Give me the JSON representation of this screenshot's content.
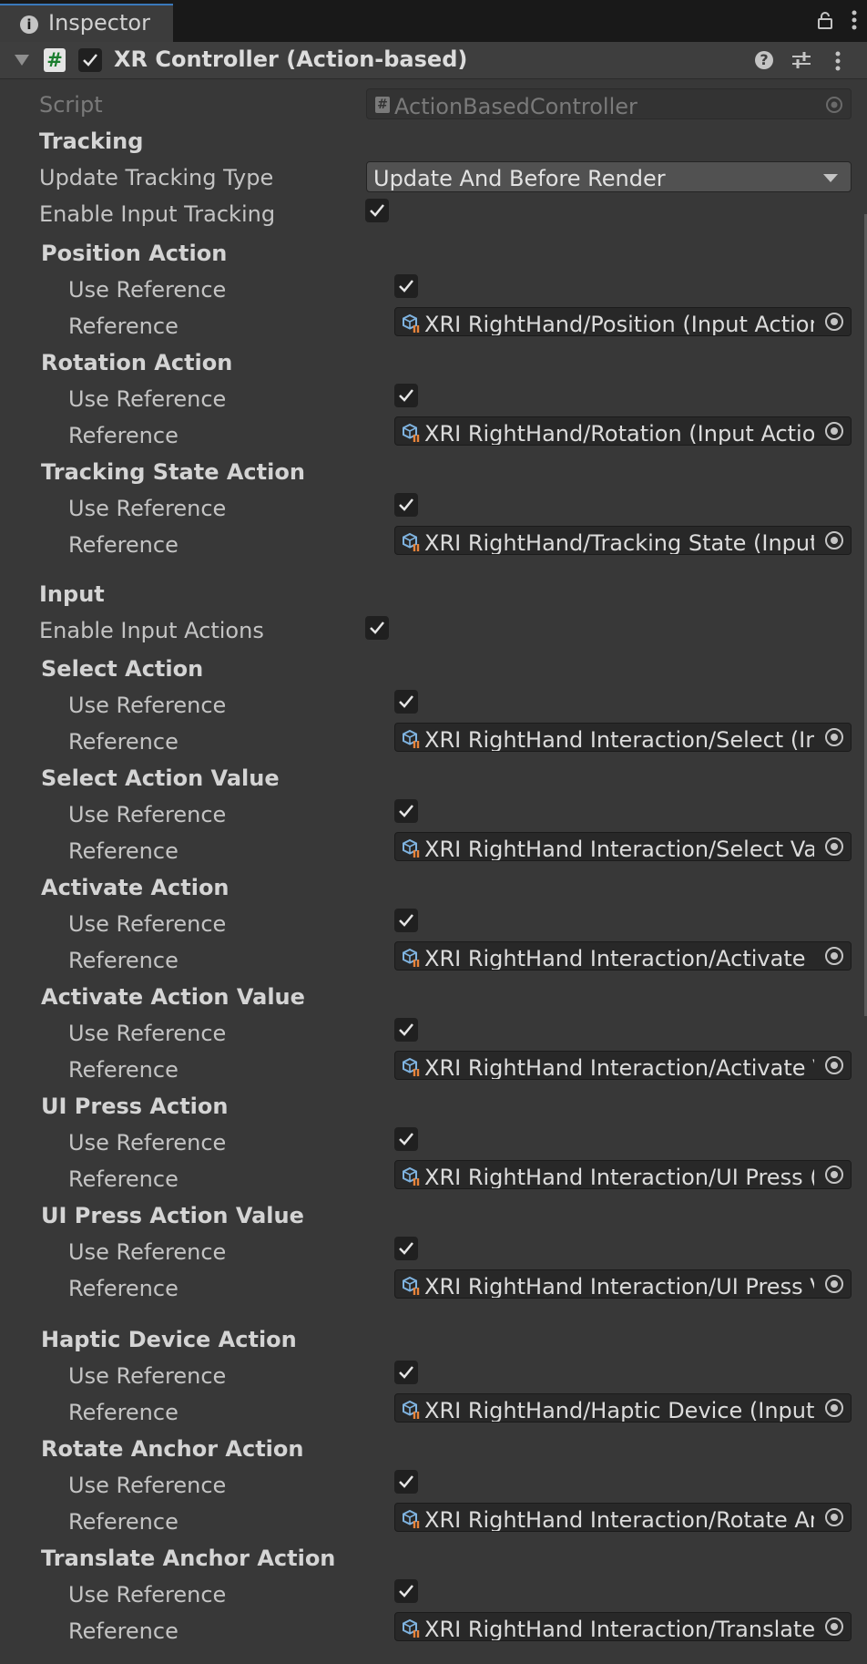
{
  "window": {
    "tab_label": "Inspector"
  },
  "component": {
    "title": "XR Controller (Action-based)"
  },
  "script": {
    "label": "Script",
    "value": "ActionBasedController"
  },
  "tracking": {
    "header": "Tracking",
    "update_tracking_type": {
      "label": "Update Tracking Type",
      "value": "Update And Before Render"
    },
    "enable_input_tracking": {
      "label": "Enable Input Tracking"
    }
  },
  "input": {
    "header": "Input",
    "enable_input_actions": {
      "label": "Enable Input Actions"
    }
  },
  "labels": {
    "use_reference": "Use Reference",
    "reference": "Reference"
  },
  "actions": [
    {
      "title": "Position Action",
      "reference": "XRI RightHand/Position (Input Action Reference)"
    },
    {
      "title": "Rotation Action",
      "reference": "XRI RightHand/Rotation (Input Action Reference)"
    },
    {
      "title": "Tracking State Action",
      "reference": "XRI RightHand/Tracking State (Input Action Reference)"
    },
    {
      "title": "Select Action",
      "reference": "XRI RightHand Interaction/Select (Input Action Reference)"
    },
    {
      "title": "Select Action Value",
      "reference": "XRI RightHand Interaction/Select Value (Input Action Reference)"
    },
    {
      "title": "Activate Action",
      "reference": "XRI RightHand Interaction/Activate (Input Action Reference)"
    },
    {
      "title": "Activate Action Value",
      "reference": "XRI RightHand Interaction/Activate Value (Input Action Reference)"
    },
    {
      "title": "UI Press Action",
      "reference": "XRI RightHand Interaction/UI Press (Input Action Reference)"
    },
    {
      "title": "UI Press Action Value",
      "reference": "XRI RightHand Interaction/UI Press Value (Input Action Reference)"
    },
    {
      "title": "Haptic Device Action",
      "reference": "XRI RightHand/Haptic Device (Input Action Reference)"
    },
    {
      "title": "Rotate Anchor Action",
      "reference": "XRI RightHand Interaction/Rotate Anchor (Input Action Reference)"
    },
    {
      "title": "Translate Anchor Action",
      "reference": "XRI RightHand Interaction/Translate Anchor (Input Action Reference)"
    }
  ],
  "colors": {
    "background": "#383838",
    "header": "#3e3e3e",
    "field": "#282828",
    "text": "#d2d2d2"
  },
  "icons": [
    "info-icon",
    "lock-icon",
    "menu-icon",
    "script-icon",
    "help-icon",
    "presets-icon",
    "input-action-reference-icon",
    "object-picker-icon"
  ]
}
